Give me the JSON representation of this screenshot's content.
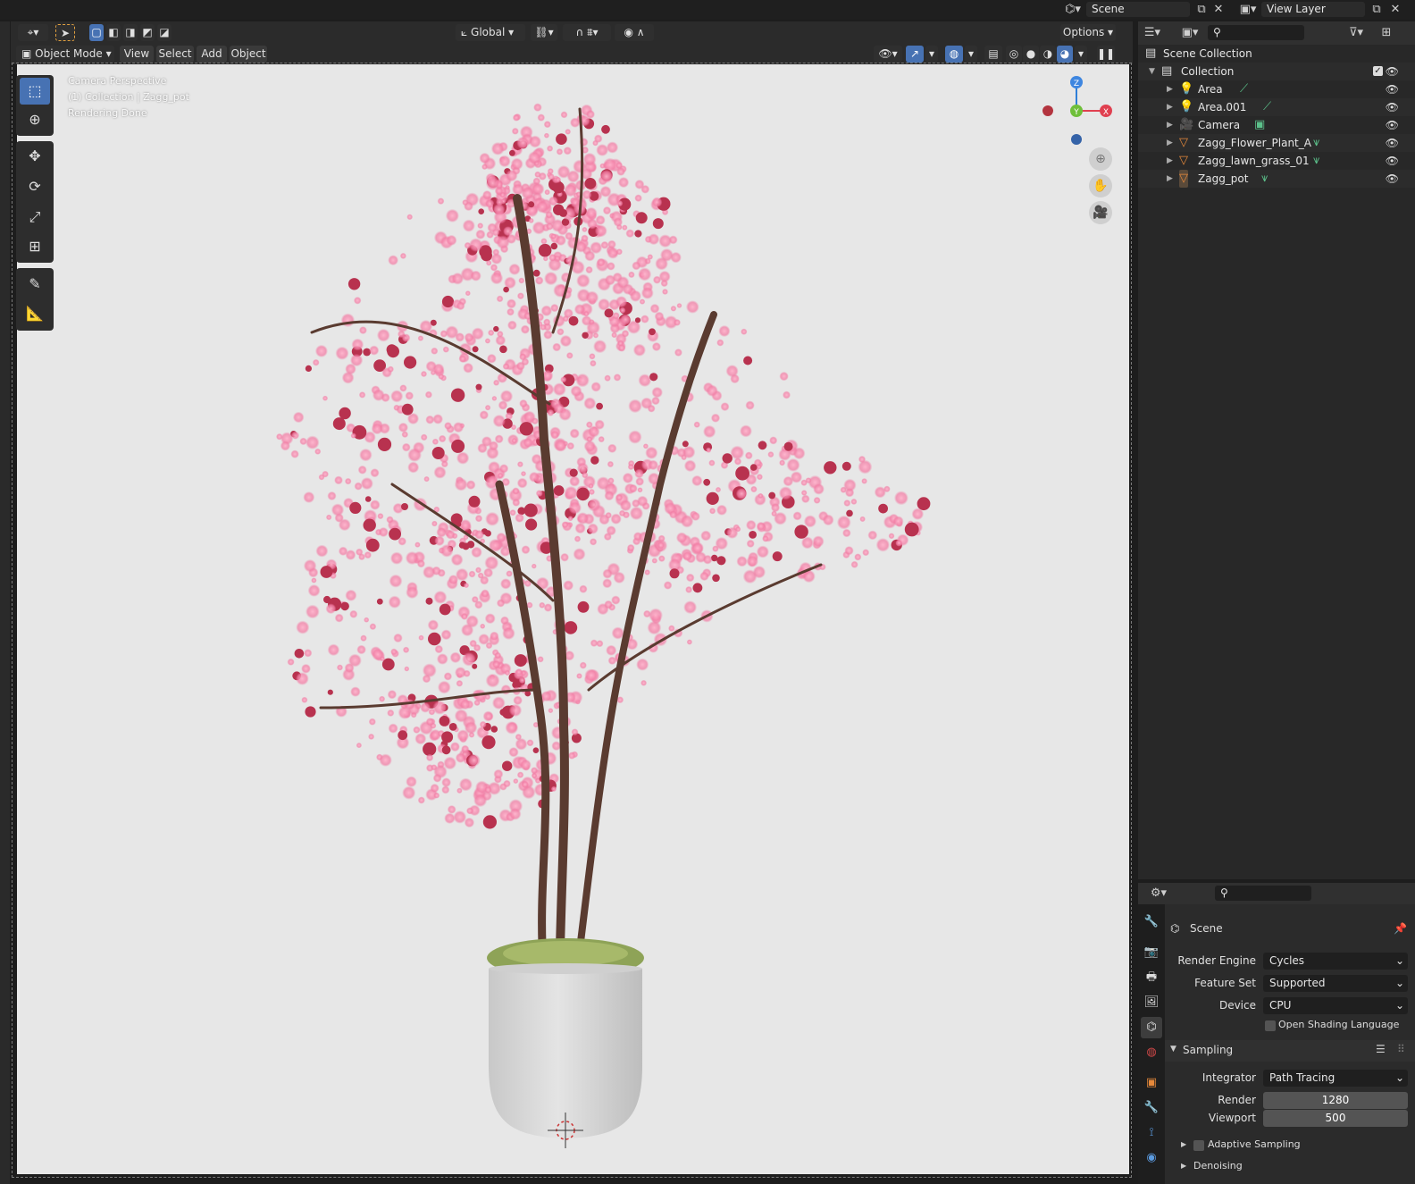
{
  "top_bar": {
    "scene_label": "Scene",
    "view_layer_label": "View Layer"
  },
  "viewport_header": {
    "orientation": "Global",
    "options": "Options",
    "mode": "Object Mode",
    "menus": [
      "View",
      "Select",
      "Add",
      "Object"
    ]
  },
  "viewport": {
    "overlay_lines": [
      "Camera Perspective",
      "(1) Collection | Zagg_pot",
      "Rendering Done"
    ],
    "gizmo": {
      "z": "Z",
      "y": "Y",
      "x": "X"
    },
    "bg_color": "#e7e7e7",
    "blossom_color": "#f27fa6",
    "pot_color": "#dadada"
  },
  "tools": [
    "select-box-icon",
    "cursor-icon",
    "move-icon",
    "rotate-icon",
    "scale-icon",
    "transform-icon",
    "annotate-icon",
    "measure-icon"
  ],
  "outliner": {
    "scene_collection": "Scene Collection",
    "collection": "Collection",
    "items": [
      {
        "name": "Area",
        "type": "light"
      },
      {
        "name": "Area.001",
        "type": "light"
      },
      {
        "name": "Camera",
        "type": "camera"
      },
      {
        "name": "Zagg_Flower_Plant_A",
        "type": "mesh"
      },
      {
        "name": "Zagg_lawn_grass_01",
        "type": "mesh"
      },
      {
        "name": "Zagg_pot",
        "type": "mesh"
      }
    ]
  },
  "properties": {
    "context": "Scene",
    "render_engine_label": "Render Engine",
    "render_engine": "Cycles",
    "feature_set_label": "Feature Set",
    "feature_set": "Supported",
    "device_label": "Device",
    "device": "CPU",
    "osl_label": "Open Shading Language",
    "sampling_label": "Sampling",
    "integrator_label": "Integrator",
    "integrator": "Path Tracing",
    "render_label": "Render",
    "render_samples": "1280",
    "viewport_label": "Viewport",
    "viewport_samples": "500",
    "adaptive_label": "Adaptive Sampling",
    "denoising_label": "Denoising"
  }
}
